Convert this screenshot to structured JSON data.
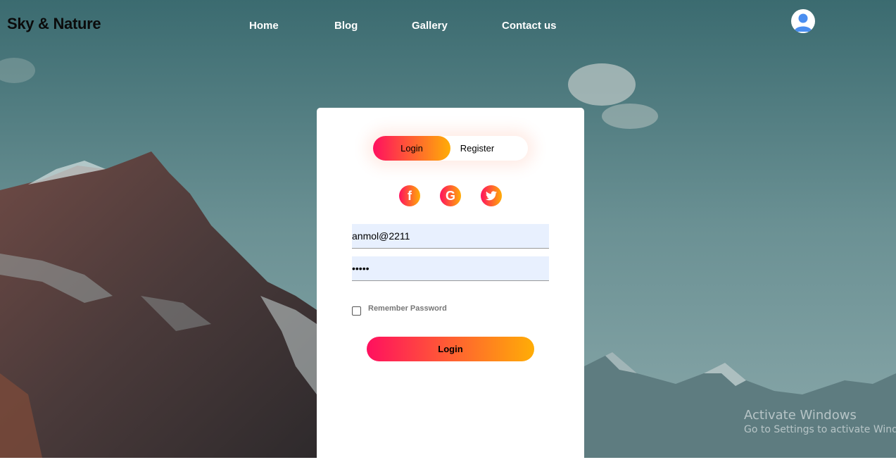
{
  "header": {
    "logo": "Sky & Nature",
    "nav": [
      "Home",
      "Blog",
      "Gallery",
      "Contact us"
    ]
  },
  "auth": {
    "tabs": {
      "login": "Login",
      "register": "Register"
    },
    "active_tab": "login",
    "social": [
      {
        "icon": "facebook-icon",
        "glyph": "f"
      },
      {
        "icon": "google-icon",
        "glyph": "G"
      },
      {
        "icon": "twitter-icon",
        "glyph": "t"
      }
    ],
    "username": {
      "value": "anmol@2211"
    },
    "password": {
      "value": "12345"
    },
    "remember_label": "Remember Password",
    "remember_checked": false,
    "submit_label": "Login"
  },
  "watermark": {
    "line1": "Activate Windows",
    "line2": "Go to Settings to activate Windows."
  },
  "colors": {
    "gradient_start": "#ff105f",
    "gradient_end": "#ffad06",
    "input_bg": "#e8f0fe",
    "avatar_blue": "#4a8ef0"
  }
}
